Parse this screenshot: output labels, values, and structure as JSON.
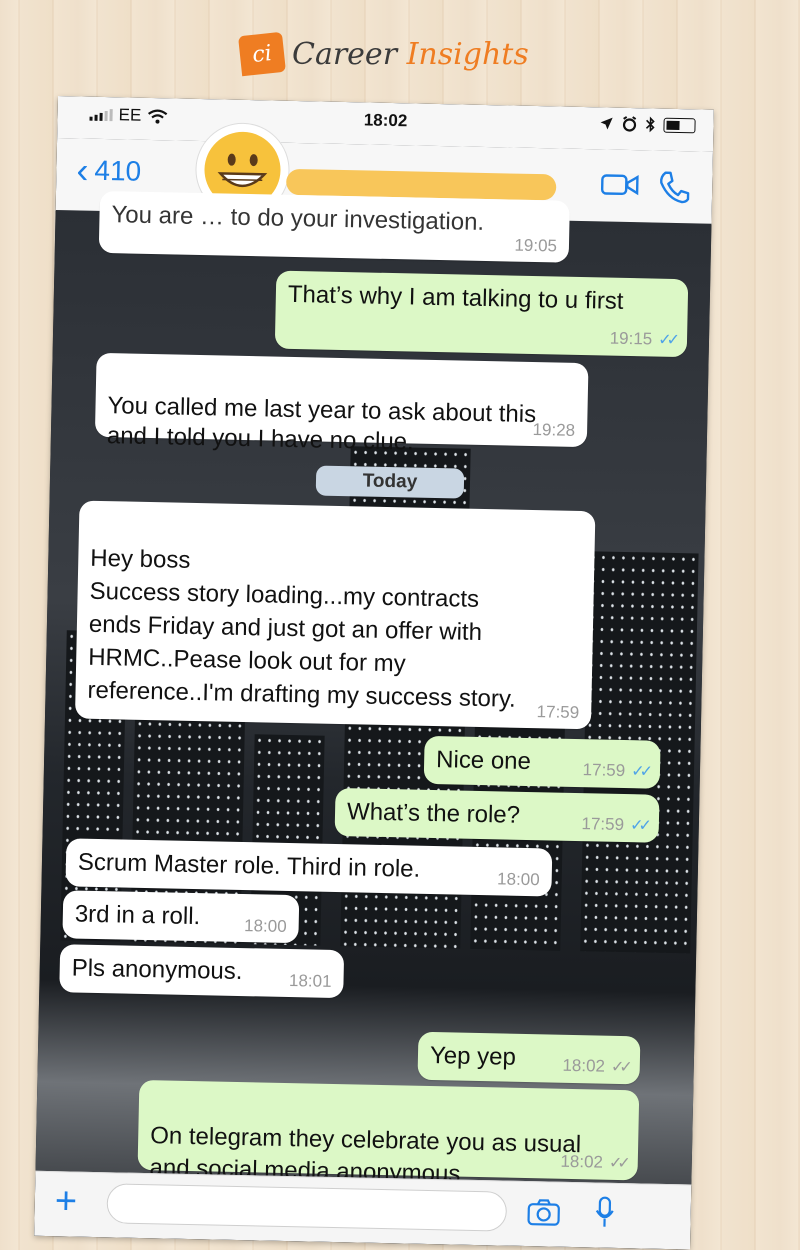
{
  "brand": {
    "logo_text": "ci",
    "name_part1": "Career",
    "name_part2": "Insights"
  },
  "status_bar": {
    "carrier": "EE",
    "time": "18:02"
  },
  "nav": {
    "back_count": "410"
  },
  "date_separator": "Today",
  "messages": [
    {
      "dir": "in",
      "text": "You are … to do your investigation.",
      "time": "19:05"
    },
    {
      "dir": "out",
      "text": "That’s why I am talking to u first",
      "time": "19:15",
      "status": "read"
    },
    {
      "dir": "in",
      "text": "You called me last year to ask about this\nand I told you I have no clue.",
      "time": "19:28"
    },
    {
      "dir": "in",
      "text": "Hey boss\nSuccess story loading...my contracts\nends Friday and just got an offer with\nHRMC..Pease look out for my\nreference..I'm drafting my success story.",
      "time": "17:59"
    },
    {
      "dir": "out",
      "text": "Nice one",
      "time": "17:59",
      "status": "read"
    },
    {
      "dir": "out",
      "text": "What’s the role?",
      "time": "17:59",
      "status": "read"
    },
    {
      "dir": "in",
      "text": "Scrum Master role. Third in  role.",
      "time": "18:00"
    },
    {
      "dir": "in",
      "text": "3rd in a roll.",
      "time": "18:00"
    },
    {
      "dir": "in",
      "text": "Pls anonymous.",
      "time": "18:01"
    },
    {
      "dir": "out",
      "text": "Yep yep",
      "time": "18:02",
      "status": "delivered"
    },
    {
      "dir": "out",
      "text": "On telegram they celebrate you as usual\nand social media anonymous",
      "time": "18:02",
      "status": "delivered"
    }
  ],
  "ticks_glyph": "✓✓",
  "colors": {
    "incoming": "#ffffff",
    "outgoing": "#dcf8c6",
    "accent": "#1d7fe6",
    "read_ticks": "#4fa3e8",
    "brand_orange": "#ef7d22"
  },
  "icons": [
    "signal-icon",
    "wifi-icon",
    "location-icon",
    "alarm-icon",
    "bluetooth-icon",
    "battery-icon",
    "video-call-icon",
    "phone-icon",
    "plus-icon",
    "camera-icon",
    "mic-icon"
  ]
}
